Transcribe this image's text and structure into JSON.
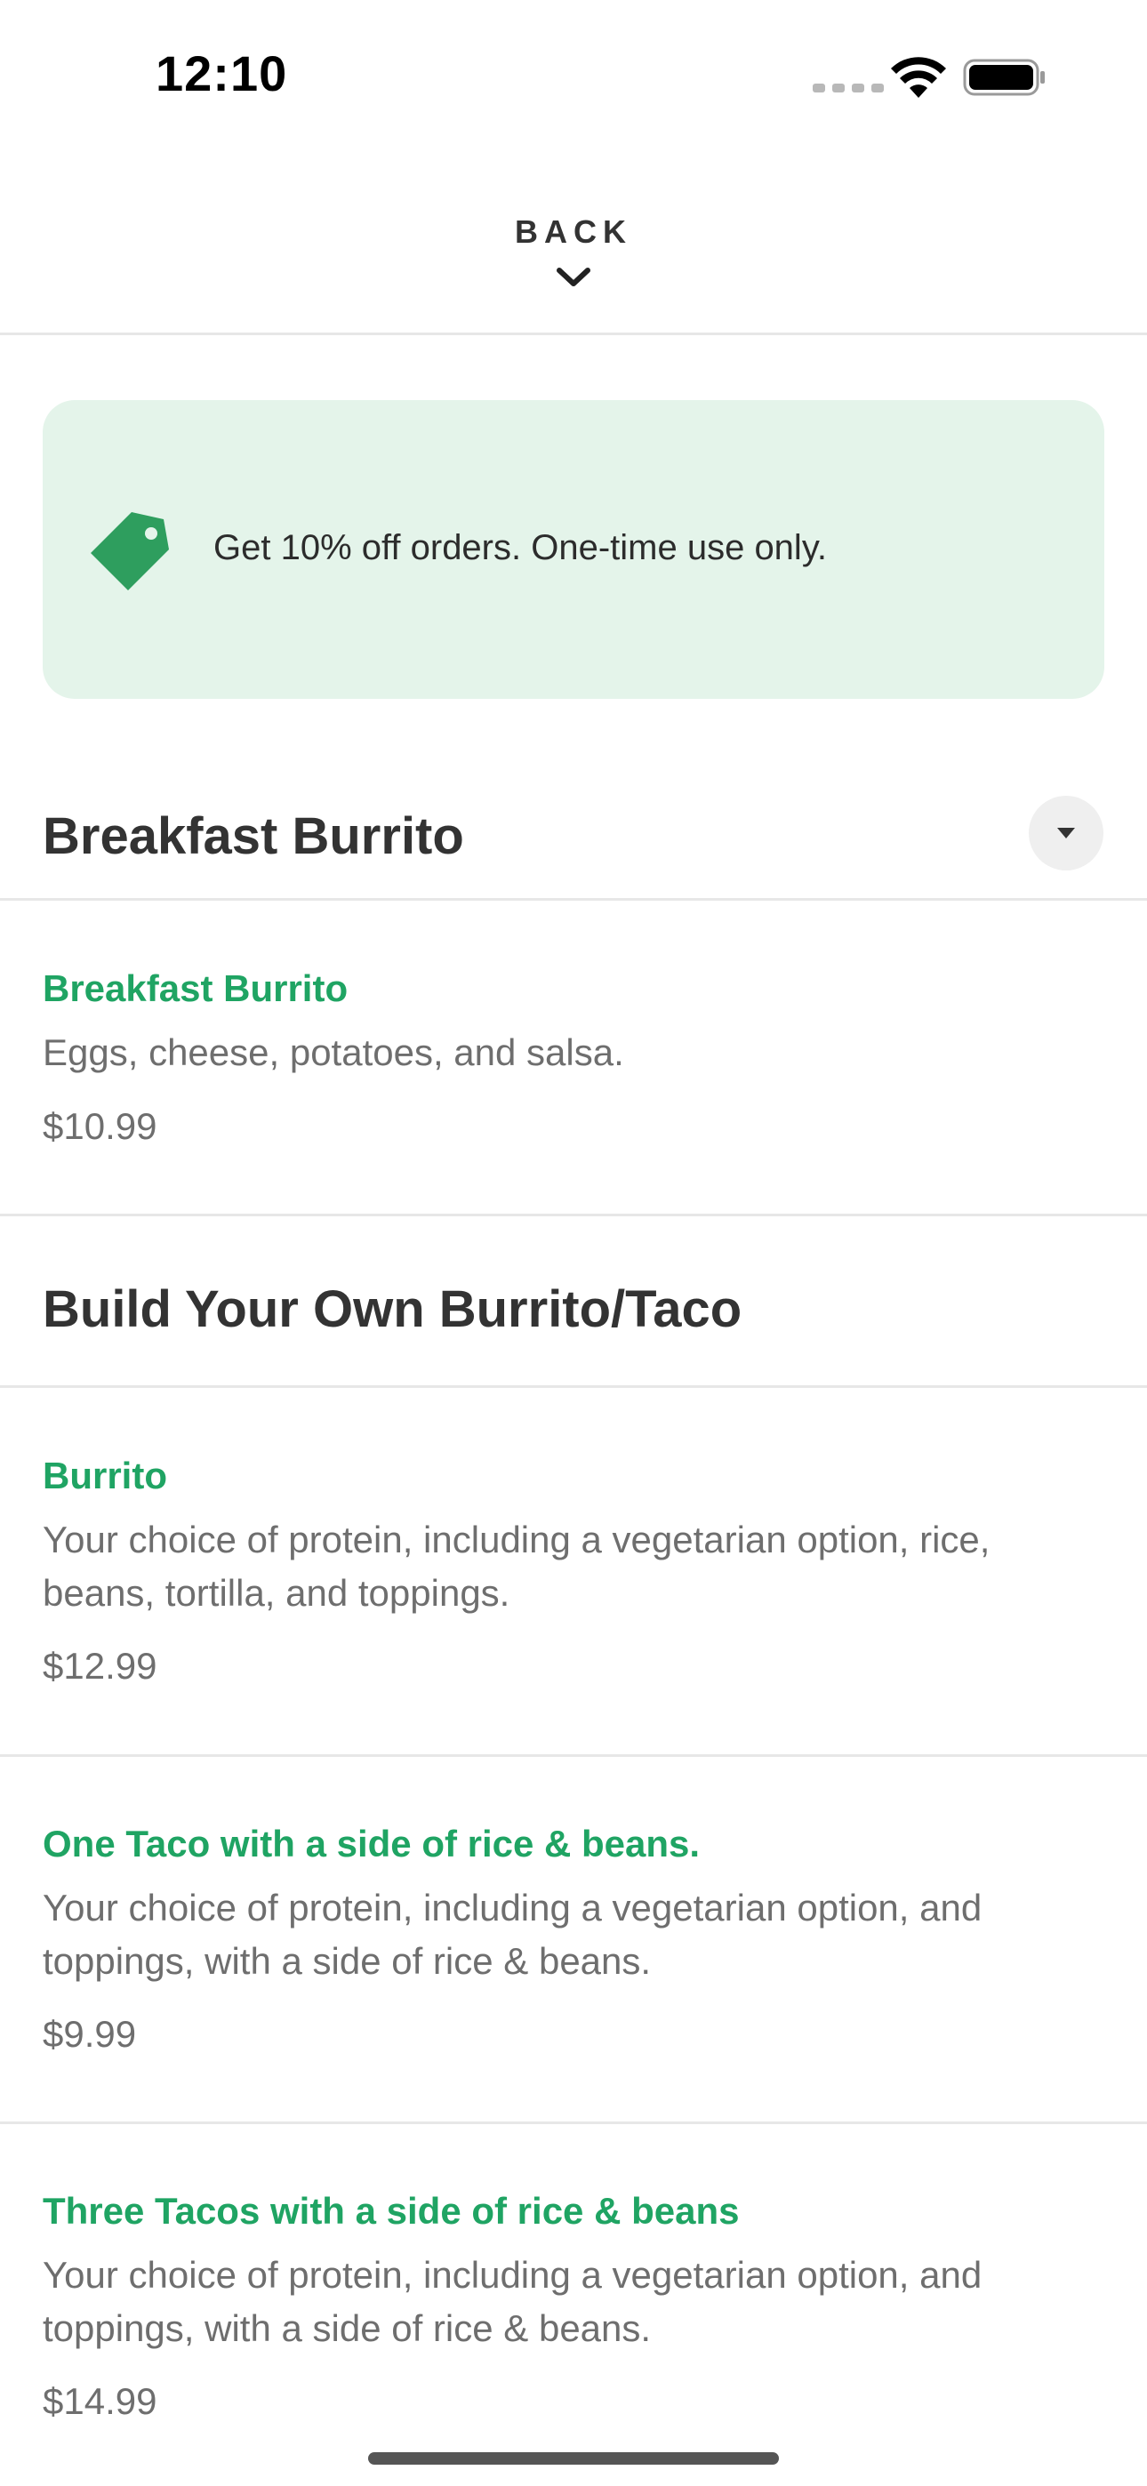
{
  "status_bar": {
    "time": "12:10",
    "icons": [
      "signal-icon",
      "wifi-icon",
      "battery-icon"
    ]
  },
  "header": {
    "back_label": "BACK",
    "back_icon": "chevron-down-icon"
  },
  "promo": {
    "icon": "tag-icon",
    "text": "Get 10% off orders. One-time use only.",
    "background_color": "#e4f4ea",
    "icon_color": "#2e9e5e"
  },
  "sections": [
    {
      "title": "Breakfast Burrito",
      "has_collapse_button": true,
      "items": [
        {
          "name": "Breakfast Burrito",
          "description": "Eggs, cheese, potatoes, and salsa.",
          "price": "$10.99"
        }
      ]
    },
    {
      "title": "Build Your Own Burrito/Taco",
      "items": [
        {
          "name": "Burrito",
          "description_lines": [
            "Your choice of protein, including a vegetarian option, rice,",
            "beans, tortilla, and toppings."
          ],
          "price": "$12.99"
        },
        {
          "name": "One Taco with a side of rice & beans.",
          "description_lines": [
            "Your choice of protein, including a vegetarian option, and",
            "toppings, with a side of rice & beans."
          ],
          "price": "$9.99"
        },
        {
          "name": "Three Tacos with a side of rice & beans",
          "description_lines": [
            "Your choice of protein, including a vegetarian option, and",
            "toppings, with a side of rice & beans."
          ],
          "price": "$14.99"
        }
      ]
    }
  ],
  "colors": {
    "accent_green": "#1fa463",
    "heading": "#333333",
    "body_text": "#6e6e6e",
    "divider": "#e7e7e7"
  }
}
